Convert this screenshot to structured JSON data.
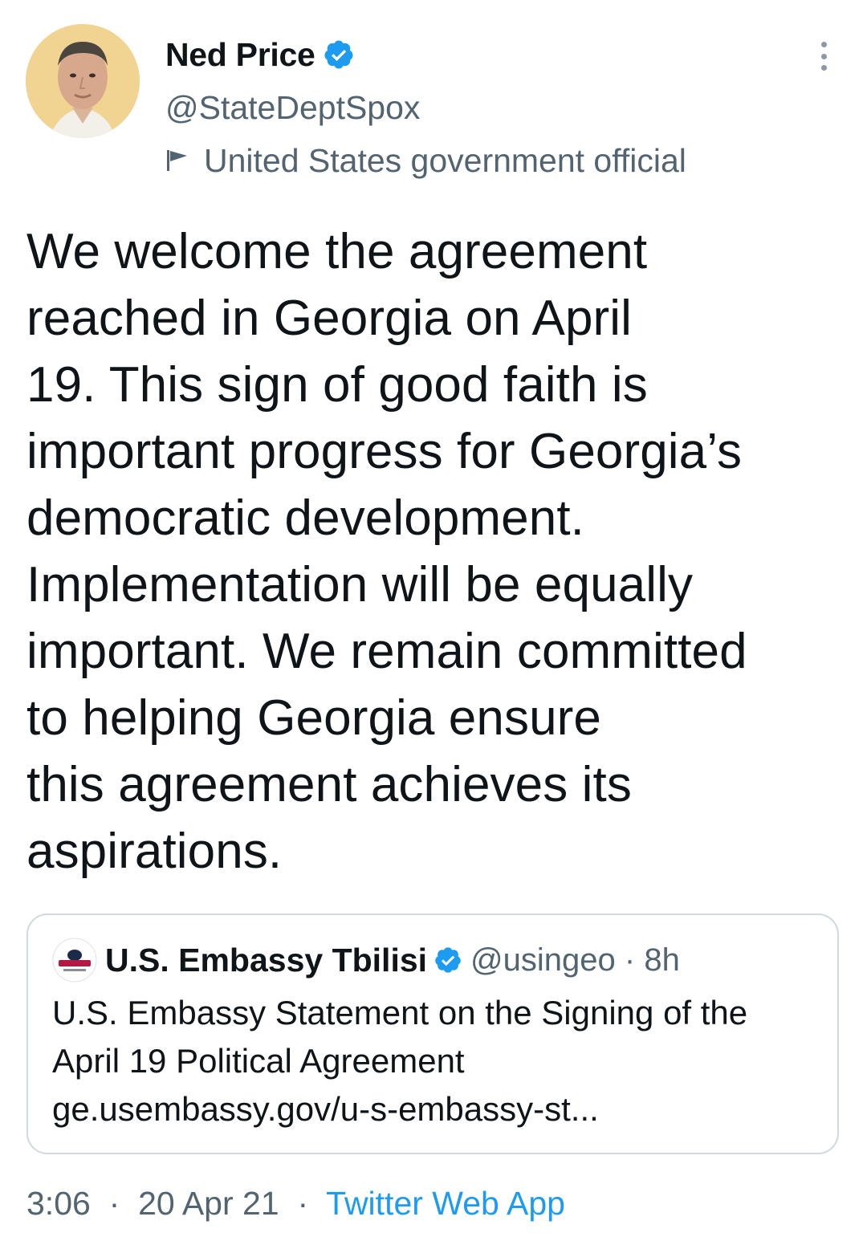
{
  "author": {
    "display_name": "Ned Price",
    "handle": "@StateDeptSpox",
    "label": "United States government official"
  },
  "icons": {
    "verified": "verified-badge-icon",
    "label": "flag-icon",
    "more": "more-options-icon"
  },
  "tweet": {
    "text": "We welcome the agreement\nreached in Georgia on April\n19. This sign of good faith is\nimportant progress for Georgia’s\ndemocratic development.\nImplementation will be equally\nimportant. We remain committed\nto helping Georgia ensure\nthis agreement achieves its\naspirations."
  },
  "quote": {
    "name": "U.S. Embassy Tbilisi",
    "handle": "@usingeo",
    "separator": "·",
    "time": "8h",
    "text": "U.S. Embassy Statement on the Signing of the April 19 Political Agreement",
    "link": "ge.usembassy.gov/u-s-embassy-st..."
  },
  "footer": {
    "time": "3:06",
    "separator": "·",
    "date": "20 Apr 21",
    "app": "Twitter Web App"
  },
  "colors": {
    "accent": "#1d9bf0",
    "secondary_text": "#536471",
    "border": "#cfd9de"
  }
}
